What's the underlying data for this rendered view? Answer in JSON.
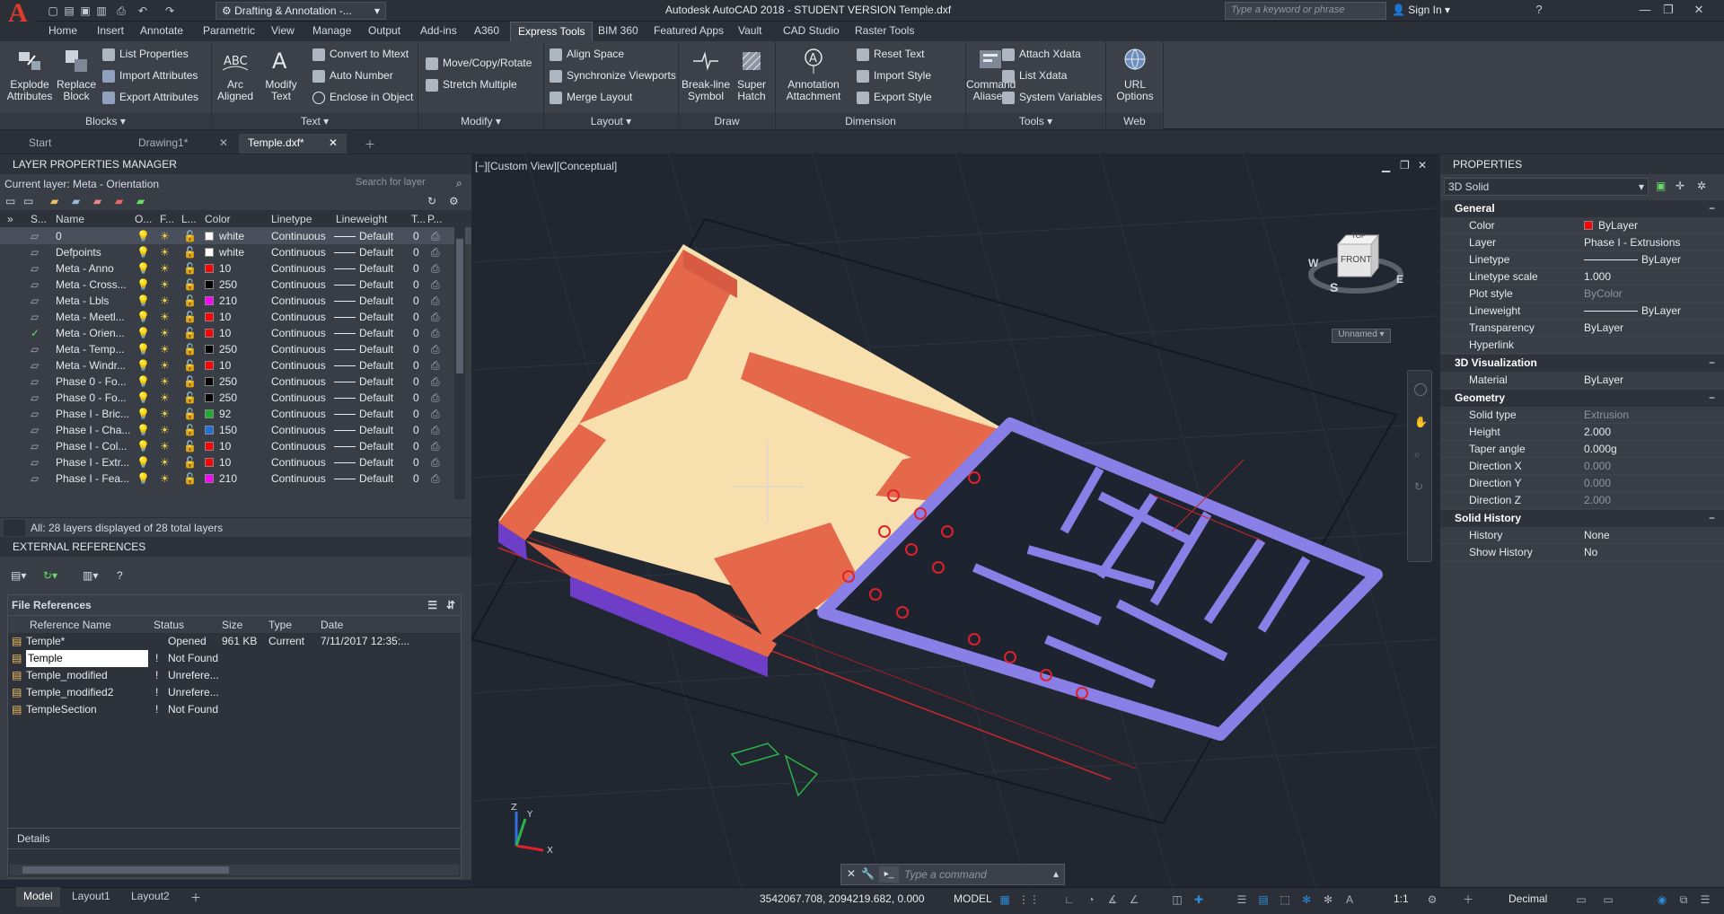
{
  "title": {
    "app_title": "Autodesk AutoCAD 2018 - STUDENT VERSION    Temple.dxf",
    "workspace": "Drafting & Annotation -...",
    "search_placeholder": "Type a keyword or phrase",
    "sign_in": "Sign In",
    "logo": "A"
  },
  "ribbon_tabs": [
    "Home",
    "Insert",
    "Annotate",
    "Parametric",
    "View",
    "Manage",
    "Output",
    "Add-ins",
    "A360",
    "Express Tools",
    "BIM 360",
    "Featured Apps",
    "Vault",
    "CAD Studio",
    "Raster Tools"
  ],
  "active_ribbon_tab": "Express Tools",
  "panels": {
    "blocks": {
      "title": "Blocks ▾",
      "explode": "Explode\nAttributes",
      "replace": "Replace\nBlock",
      "list_props": "List Properties",
      "import_attr": "Import Attributes",
      "export_attr": "Export Attributes"
    },
    "text": {
      "title": "Text ▾",
      "arc": "Arc\nAligned",
      "modify": "Modify\nText",
      "convert": "Convert to Mtext",
      "auto_number": "Auto Number",
      "enclose": "Enclose in Object"
    },
    "modify": {
      "title": "Modify ▾",
      "move_copy": "Move/Copy/Rotate",
      "stretch": "Stretch Multiple"
    },
    "layout": {
      "title": "Layout ▾",
      "align_space": "Align Space",
      "sync": "Synchronize Viewports",
      "merge": "Merge Layout"
    },
    "draw": {
      "title": "Draw",
      "breakline": "Break-line\nSymbol",
      "super_hatch": "Super\nHatch"
    },
    "dimension": {
      "title": "Dimension",
      "annotation": "Annotation\nAttachment",
      "reset_text": "Reset Text",
      "import_style": "Import Style",
      "export_style": "Export Style"
    },
    "tools": {
      "title": "Tools ▾",
      "cmd_alias": "Command\nAliases",
      "attach_xdata": "Attach Xdata",
      "list_xdata": "List Xdata",
      "sys_vars": "System Variables"
    },
    "web": {
      "title": "Web",
      "url": "URL\nOptions"
    }
  },
  "doc_tabs": [
    "Start",
    "Drawing1*",
    "Temple.dxf*"
  ],
  "active_doc_tab": "Temple.dxf*",
  "layer_manager": {
    "title": "LAYER PROPERTIES MANAGER",
    "current_layer": "Current layer: Meta - Orientation",
    "search_placeholder": "Search for layer",
    "columns": [
      "S...",
      "Name",
      "O...",
      "F...",
      "L...",
      "Color",
      "Linetype",
      "Lineweight",
      "T...",
      "P..."
    ],
    "rows": [
      {
        "name": "0",
        "color": "#ffffff",
        "color_name": "white",
        "linetype": "Continuous",
        "lineweight": "Default",
        "t": "0"
      },
      {
        "name": "Defpoints",
        "color": "#ffffff",
        "color_name": "white",
        "linetype": "Continuous",
        "lineweight": "Default",
        "t": "0"
      },
      {
        "name": "Meta - Anno",
        "color": "#ff0000",
        "color_name": "10",
        "linetype": "Continuous",
        "lineweight": "Default",
        "t": "0"
      },
      {
        "name": "Meta - Cross...",
        "color": "#000000",
        "color_name": "250",
        "linetype": "Continuous",
        "lineweight": "Default",
        "t": "0"
      },
      {
        "name": "Meta - Lbls",
        "color": "#ff00ff",
        "color_name": "210",
        "linetype": "Continuous",
        "lineweight": "Default",
        "t": "0"
      },
      {
        "name": "Meta - Meetl...",
        "color": "#ff0000",
        "color_name": "10",
        "linetype": "Continuous",
        "lineweight": "Default",
        "t": "0"
      },
      {
        "name": "Meta - Orien...",
        "color": "#ff0000",
        "color_name": "10",
        "linetype": "Continuous",
        "lineweight": "Default",
        "t": "0"
      },
      {
        "name": "Meta - Temp...",
        "color": "#000000",
        "color_name": "250",
        "linetype": "Continuous",
        "lineweight": "Default",
        "t": "0"
      },
      {
        "name": "Meta - Windr...",
        "color": "#ff0000",
        "color_name": "10",
        "linetype": "Continuous",
        "lineweight": "Default",
        "t": "0"
      },
      {
        "name": "Phase 0 - Fo...",
        "color": "#000000",
        "color_name": "250",
        "linetype": "Continuous",
        "lineweight": "Default",
        "t": "0"
      },
      {
        "name": "Phase 0 - Fo...",
        "color": "#000000",
        "color_name": "250",
        "linetype": "Continuous",
        "lineweight": "Default",
        "t": "0"
      },
      {
        "name": "Phase I - Bric...",
        "color": "#1fae2b",
        "color_name": "92",
        "linetype": "Continuous",
        "lineweight": "Default",
        "t": "0"
      },
      {
        "name": "Phase I - Cha...",
        "color": "#1e6fe0",
        "color_name": "150",
        "linetype": "Continuous",
        "lineweight": "Default",
        "t": "0"
      },
      {
        "name": "Phase I - Col...",
        "color": "#ff0000",
        "color_name": "10",
        "linetype": "Continuous",
        "lineweight": "Default",
        "t": "0"
      },
      {
        "name": "Phase I - Extr...",
        "color": "#ff0000",
        "color_name": "10",
        "linetype": "Continuous",
        "lineweight": "Default",
        "t": "0"
      },
      {
        "name": "Phase I - Fea...",
        "color": "#ff00ff",
        "color_name": "210",
        "linetype": "Continuous",
        "lineweight": "Default",
        "t": "0"
      }
    ],
    "footer": "All: 28 layers displayed of 28 total layers"
  },
  "xref": {
    "title": "EXTERNAL REFERENCES",
    "file_refs": "File References",
    "columns": [
      "Reference Name",
      "Status",
      "Size",
      "Type",
      "Date"
    ],
    "rows": [
      {
        "name": "Temple*",
        "status": "Opened",
        "size": "961 KB",
        "type": "Current",
        "date": "7/11/2017 12:35:..."
      },
      {
        "name": "Temple",
        "status": "Not Found",
        "size": "",
        "type": "",
        "date": ""
      },
      {
        "name": "Temple_modified",
        "status": "Unrefere...",
        "size": "",
        "type": "",
        "date": ""
      },
      {
        "name": "Temple_modified2",
        "status": "Unrefere...",
        "size": "",
        "type": "",
        "date": ""
      },
      {
        "name": "TempleSection",
        "status": "Not Found",
        "size": "",
        "type": "",
        "date": ""
      }
    ],
    "details": "Details"
  },
  "viewport": {
    "label": "[−][Custom View][Conceptual]",
    "cube_top": "TOP",
    "cube_front": "FRONT",
    "compass": {
      "w": "W",
      "e": "E",
      "s": "S"
    },
    "ucs": "Unnamed",
    "axis_x": "X",
    "axis_y": "Y",
    "axis_z": "Z"
  },
  "command": {
    "placeholder": "Type a command"
  },
  "properties": {
    "title": "PROPERTIES",
    "selection": "3D Solid",
    "general": {
      "label": "General",
      "rows": [
        [
          "Color",
          "ByLayer"
        ],
        [
          "Layer",
          "Phase I - Extrusions"
        ],
        [
          "Linetype",
          "ByLayer"
        ],
        [
          "Linetype scale",
          "1.000"
        ],
        [
          "Plot style",
          "ByColor"
        ],
        [
          "Lineweight",
          "ByLayer"
        ],
        [
          "Transparency",
          "ByLayer"
        ],
        [
          "Hyperlink",
          ""
        ]
      ]
    },
    "viz": {
      "label": "3D Visualization",
      "rows": [
        [
          "Material",
          "ByLayer"
        ]
      ]
    },
    "geometry": {
      "label": "Geometry",
      "rows": [
        [
          "Solid type",
          "Extrusion"
        ],
        [
          "Height",
          "2.000"
        ],
        [
          "Taper angle",
          "0.000g"
        ],
        [
          "Direction X",
          "0.000"
        ],
        [
          "Direction Y",
          "0.000"
        ],
        [
          "Direction Z",
          "2.000"
        ]
      ]
    },
    "history": {
      "label": "Solid History",
      "rows": [
        [
          "History",
          "None"
        ],
        [
          "Show History",
          "No"
        ]
      ]
    },
    "minus": "−"
  },
  "status": {
    "tabs": [
      "Model",
      "Layout1",
      "Layout2"
    ],
    "coords": "3542067.708, 2094219.682, 0.000",
    "space": "MODEL",
    "scale": "1:1",
    "units": "Decimal"
  },
  "colors": {
    "accent": "#2e8bd6",
    "building_orange": "#e6684b",
    "building_purple": "#8a7fe6",
    "floor": "#f8dfae"
  }
}
